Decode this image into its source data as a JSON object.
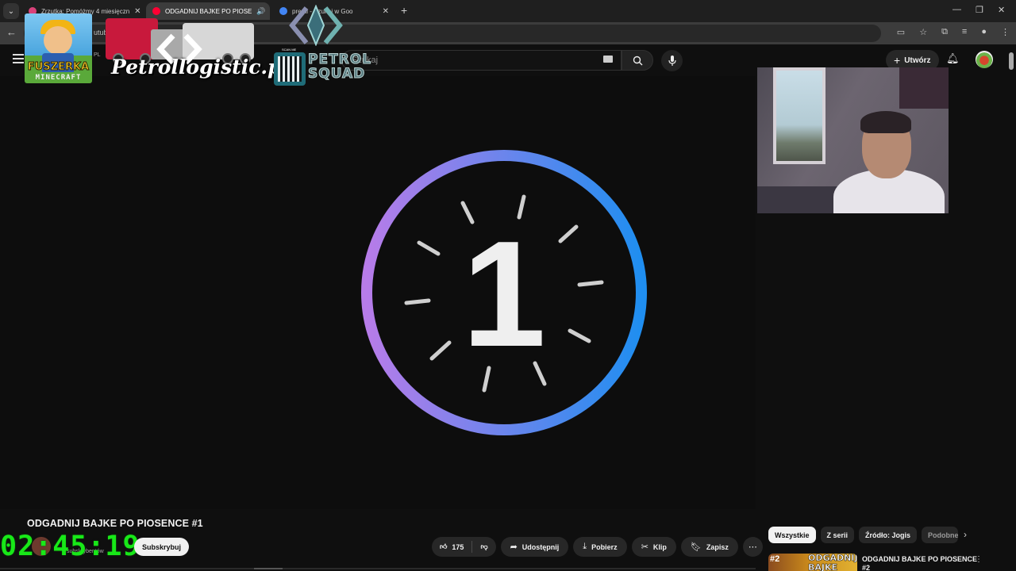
{
  "browser": {
    "tabs": [
      {
        "title": "Zrzutka: Pomóżmy 4 miesięczn",
        "active": false,
        "favicon_color": "#d9427a"
      },
      {
        "title": "ODGADNIJ BAJKE PO PIOSE",
        "active": true,
        "favicon_color": "#ff0033"
      },
      {
        "title": "premi - Szukaj w Goo",
        "active": false,
        "favicon_color": "#4285f4"
      }
    ],
    "url_fragment": "utub"
  },
  "youtube": {
    "country_code": "PL",
    "search_placeholder": "Szukaj",
    "create_label": "Utwórz"
  },
  "player": {
    "countdown_number": "1",
    "ring_colors": [
      "#b77ce9",
      "#1f8ef0"
    ]
  },
  "overlays": {
    "fuszerka_line1": "FUSZERKA",
    "fuszerka_line2": "MINECRAFT",
    "petrol_site": "Petrollogistic.pl",
    "squad_line1": "PETROL",
    "squad_line2": "SQUAD",
    "scan_me": "SCAN ME",
    "timer": "02:45:19"
  },
  "video": {
    "title": "ODGADNIJ BAJKE PO PIOSENCE #1",
    "subscribers": "subskrybentów",
    "subscribe_label": "Subskrybuj",
    "likes": "175",
    "share_label": "Udostępnij",
    "download_label": "Pobierz",
    "clip_label": "Klip",
    "save_label": "Zapisz"
  },
  "sidebar": {
    "chips": [
      "Wszystkie",
      "Z serii",
      "Źródło: Jogis",
      "Podobne"
    ],
    "recommended": {
      "thumb_number": "#2",
      "thumb_text": "ODGADNIJ BAJKE",
      "title": "ODGADNIJ BAJKE PO PIOSENCE #2"
    }
  }
}
